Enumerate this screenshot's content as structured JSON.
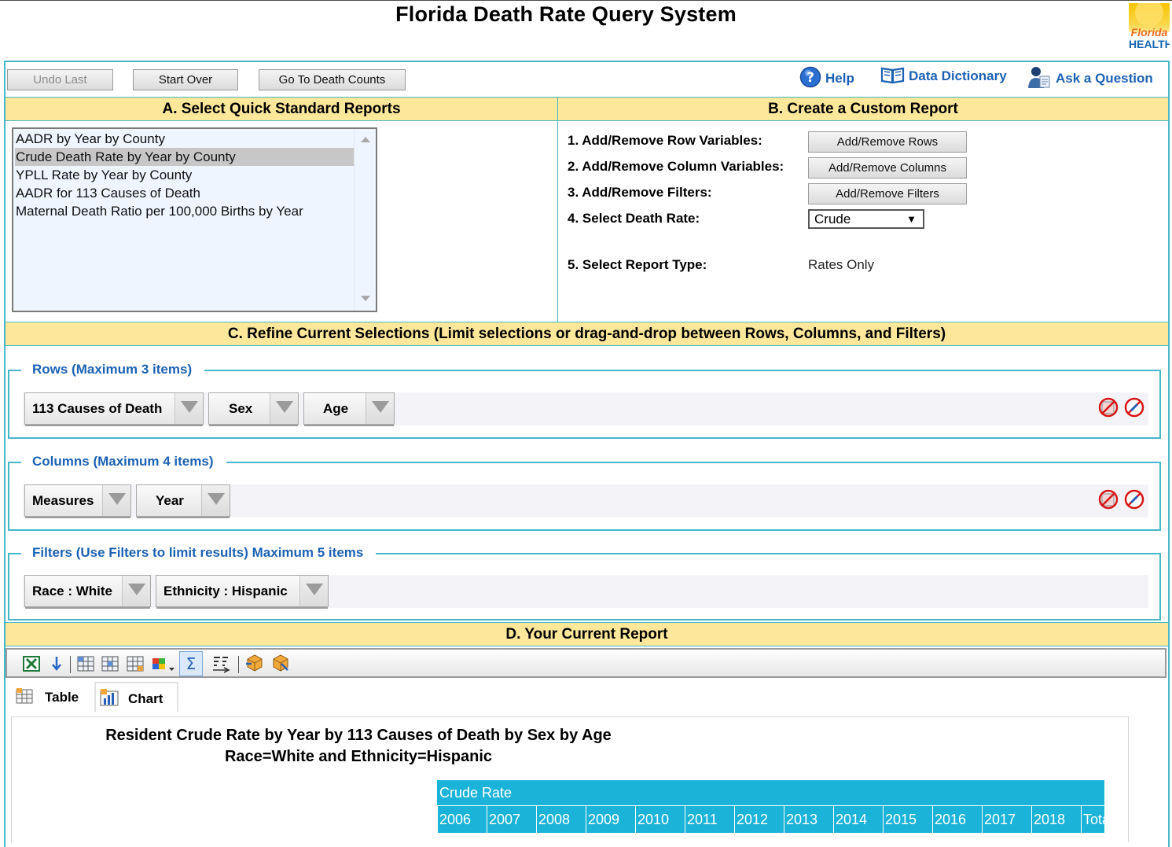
{
  "title": "Florida Death Rate Query System",
  "logo": {
    "line1": "Florida",
    "line2": "HEALTH"
  },
  "toolbar_buttons": {
    "undo": "Undo Last",
    "start_over": "Start Over",
    "go_to_counts": "Go To Death Counts"
  },
  "top_links": {
    "help": "Help",
    "dictionary": "Data Dictionary",
    "ask": "Ask a Question"
  },
  "section_a": {
    "title": "A. Select Quick Standard Reports",
    "reports": [
      "AADR by Year by County",
      "Crude Death Rate by Year by County",
      "YPLL Rate by Year by County",
      "AADR for 113 Causes of Death",
      "Maternal Death Ratio per 100,000 Births by Year"
    ],
    "selected_index": 1
  },
  "section_b": {
    "title": "B. Create a Custom Report",
    "steps": [
      {
        "label": "1. Add/Remove Row Variables:",
        "button": "Add/Remove Rows"
      },
      {
        "label": "2. Add/Remove Column Variables:",
        "button": "Add/Remove Columns"
      },
      {
        "label": "3. Add/Remove Filters:",
        "button": "Add/Remove Filters"
      },
      {
        "label": "4. Select Death Rate:",
        "value": "Crude"
      },
      {
        "label": "5. Select Report Type:",
        "value": "Rates Only"
      }
    ]
  },
  "section_c": {
    "title": "C. Refine Current Selections (Limit selections or drag-and-drop between Rows, Columns, and Filters)",
    "rows": {
      "legend": "Rows (Maximum 3 items)",
      "items": [
        "113 Causes of Death",
        "Sex",
        "Age"
      ]
    },
    "columns": {
      "legend": "Columns (Maximum 4 items)",
      "items": [
        "Measures",
        "Year"
      ]
    },
    "filters": {
      "legend": "Filters (Use Filters to limit results) Maximum 5 items",
      "items": [
        "Race : White",
        "Ethnicity : Hispanic"
      ]
    }
  },
  "section_d": {
    "title": "D. Your Current Report",
    "tabs": [
      "Table",
      "Chart"
    ],
    "report_title": "Resident Crude Rate by Year by 113 Causes of Death by Sex by Age",
    "report_subtitle": "Race=White and Ethnicity=Hispanic",
    "grid": {
      "measure": "Crude Rate",
      "years": [
        "2006",
        "2007",
        "2008",
        "2009",
        "2010",
        "2011",
        "2012",
        "2013",
        "2014",
        "2015",
        "2016",
        "2017",
        "2018",
        "Total"
      ]
    }
  },
  "icons": {
    "toolbar": [
      "excel-export-icon",
      "download-arrow-icon",
      "table-layout-1-icon",
      "table-layout-2-icon",
      "table-layout-3-icon",
      "color-palette-icon",
      "sum-icon",
      "sort-icon",
      "cube-1-icon",
      "cube-2-icon"
    ],
    "clear": [
      "clear-all-icon",
      "disable-icon"
    ]
  },
  "colors": {
    "accent": "#46b8c8",
    "header_bg": "#fde79b",
    "link": "#1c62b4",
    "grid_bg": "#1cb3d8"
  }
}
